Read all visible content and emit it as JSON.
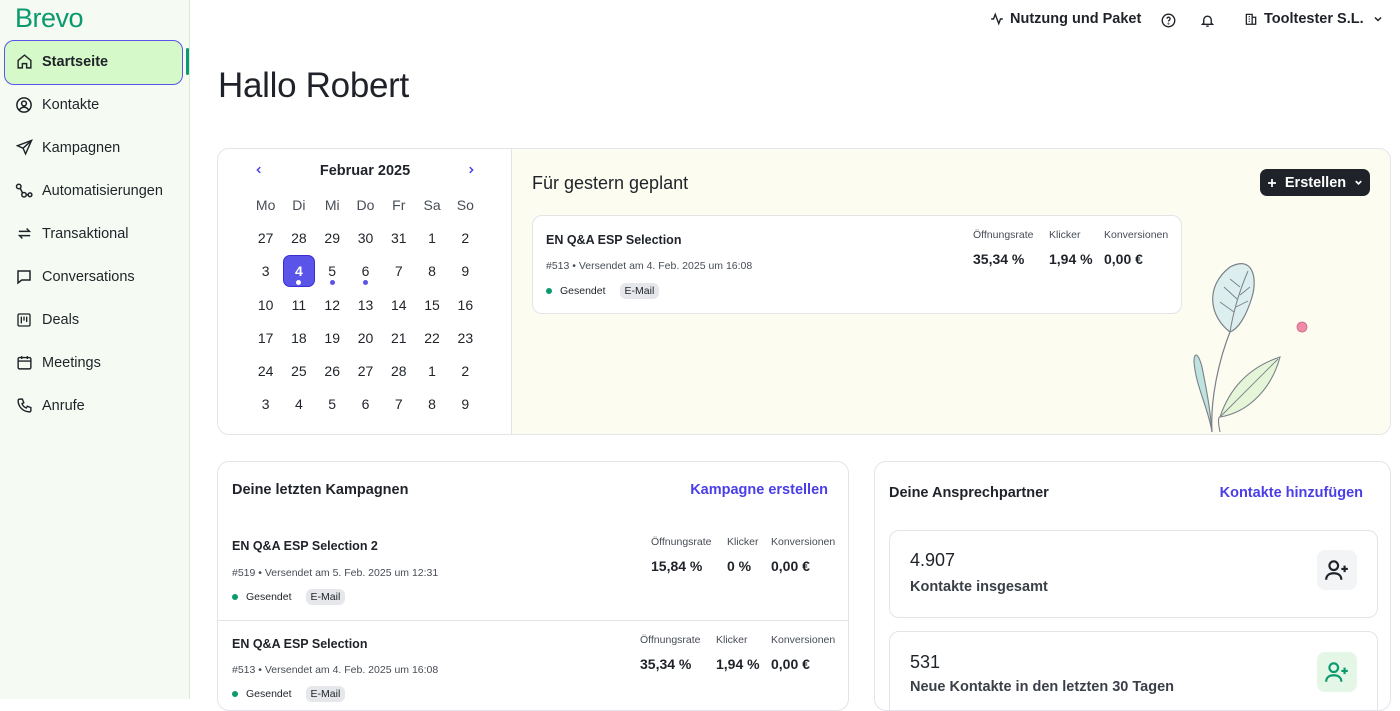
{
  "app": {
    "logo": "Brevo"
  },
  "sidebar": {
    "items": [
      {
        "label": "Startseite",
        "icon": "home-icon",
        "active": true
      },
      {
        "label": "Kontakte",
        "icon": "contact-icon"
      },
      {
        "label": "Kampagnen",
        "icon": "send-icon"
      },
      {
        "label": "Automatisierungen",
        "icon": "automation-icon"
      },
      {
        "label": "Transaktional",
        "icon": "transactional-icon"
      },
      {
        "label": "Conversations",
        "icon": "chat-icon"
      },
      {
        "label": "Deals",
        "icon": "deals-icon"
      },
      {
        "label": "Meetings",
        "icon": "calendar-icon"
      },
      {
        "label": "Anrufe",
        "icon": "phone-icon"
      }
    ]
  },
  "topbar": {
    "usage_label": "Nutzung und Paket",
    "account_label": "Tooltester S.L."
  },
  "greeting": "Hallo Robert",
  "calendar": {
    "month_label": "Februar 2025",
    "weekdays": [
      "Mo",
      "Di",
      "Mi",
      "Do",
      "Fr",
      "Sa",
      "So"
    ],
    "weeks": [
      [
        "27",
        "28",
        "29",
        "30",
        "31",
        "1",
        "2"
      ],
      [
        "3",
        "4",
        "5",
        "6",
        "7",
        "8",
        "9"
      ],
      [
        "10",
        "11",
        "12",
        "13",
        "14",
        "15",
        "16"
      ],
      [
        "17",
        "18",
        "19",
        "20",
        "21",
        "22",
        "23"
      ],
      [
        "24",
        "25",
        "26",
        "27",
        "28",
        "1",
        "2"
      ],
      [
        "3",
        "4",
        "5",
        "6",
        "7",
        "8",
        "9"
      ]
    ],
    "selected_day": "4",
    "event_days": [
      "4",
      "5",
      "6"
    ]
  },
  "scheduled": {
    "title": "Für gestern geplant",
    "create_label": "Erstellen",
    "campaign": {
      "name": "EN Q&A ESP Selection",
      "meta": "#513  •  Versendet am 4. Feb. 2025 um 16:08",
      "status": "Gesendet",
      "tag": "E-Mail",
      "metrics": [
        {
          "label": "Öffnungsrate",
          "value": "35,34 %"
        },
        {
          "label": "Klicker",
          "value": "1,94 %"
        },
        {
          "label": "Konversionen",
          "value": "0,00 €"
        }
      ]
    }
  },
  "recent": {
    "title": "Deine letzten Kampagnen",
    "link": "Kampagne erstellen",
    "campaigns": [
      {
        "name": "EN Q&A ESP Selection 2",
        "meta": "#519  •  Versendet am 5. Feb. 2025 um 12:31",
        "status": "Gesendet",
        "tag": "E-Mail",
        "metrics": [
          {
            "label": "Öffnungsrate",
            "value": "15,84 %"
          },
          {
            "label": "Klicker",
            "value": "0 %"
          },
          {
            "label": "Konversionen",
            "value": "0,00 €"
          }
        ]
      },
      {
        "name": "EN Q&A ESP Selection",
        "meta": "#513  •  Versendet am 4. Feb. 2025 um 16:08",
        "status": "Gesendet",
        "tag": "E-Mail",
        "metrics": [
          {
            "label": "Öffnungsrate",
            "value": "35,34 %"
          },
          {
            "label": "Klicker",
            "value": "1,94 %"
          },
          {
            "label": "Konversionen",
            "value": "0,00 €"
          }
        ]
      }
    ]
  },
  "contacts": {
    "title": "Deine Ansprechpartner",
    "link": "Kontakte hinzufügen",
    "stats": [
      {
        "value": "4.907",
        "label": "Kontakte insgesamt",
        "icon": "add-user-icon"
      },
      {
        "value": "531",
        "label": "Neue Kontakte in den letzten 30 Tagen",
        "icon": "add-user-icon"
      }
    ]
  },
  "colors": {
    "brand": "#0b996e",
    "accent": "#5b54e8",
    "link": "#4a3ee8"
  }
}
